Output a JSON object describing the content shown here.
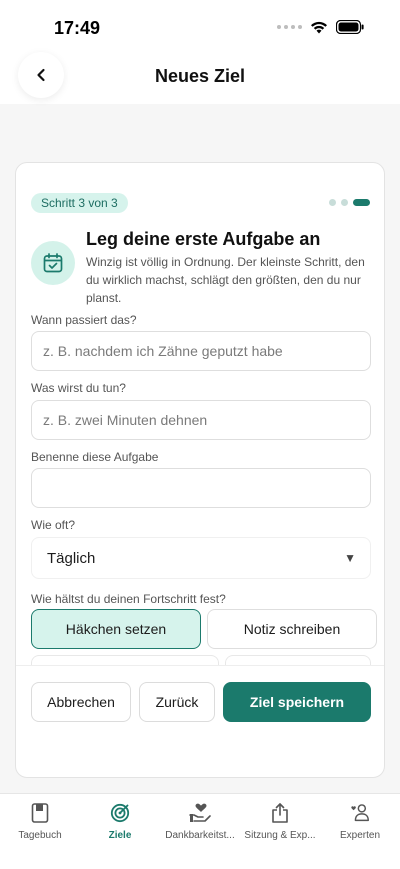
{
  "status": {
    "time": "17:49"
  },
  "header": {
    "title": "Neues Ziel"
  },
  "step": {
    "badge": "Schritt 3 von 3",
    "current": 3,
    "total": 3
  },
  "card": {
    "title": "Leg deine erste Aufgabe an",
    "subtitle": "Winzig ist völlig in Ordnung. Der kleinste Schritt, den du wirklich machst, schlägt den größten, den du nur planst."
  },
  "fields": {
    "when": {
      "label": "Wann passiert das?",
      "placeholder": "z. B. nachdem ich Zähne geputzt habe",
      "value": ""
    },
    "what": {
      "label": "Was wirst du tun?",
      "placeholder": "z. B. zwei Minuten dehnen",
      "value": ""
    },
    "name": {
      "label": "Benenne diese Aufgabe",
      "placeholder": "",
      "value": ""
    },
    "frequency": {
      "label": "Wie oft?",
      "value": "Täglich"
    },
    "tracking": {
      "label": "Wie hältst du deinen Fortschritt fest?",
      "options": [
        "Häkchen setzen",
        "Notiz schreiben"
      ],
      "selected": "Häkchen setzen"
    }
  },
  "actions": {
    "cancel": "Abbrechen",
    "back": "Zurück",
    "save": "Ziel speichern"
  },
  "nav": {
    "items": [
      {
        "label": "Tagebuch",
        "icon": "book-icon"
      },
      {
        "label": "Ziele",
        "icon": "target-icon"
      },
      {
        "label": "Dankbarkeitst...",
        "icon": "heart-hand-icon"
      },
      {
        "label": "Sitzung & Exp...",
        "icon": "share-icon"
      },
      {
        "label": "Experten",
        "icon": "experts-icon"
      }
    ],
    "active": "Ziele"
  },
  "colors": {
    "accent": "#1b7a6c",
    "accent_light": "#d6f3ec",
    "background": "#f6f6f6"
  }
}
